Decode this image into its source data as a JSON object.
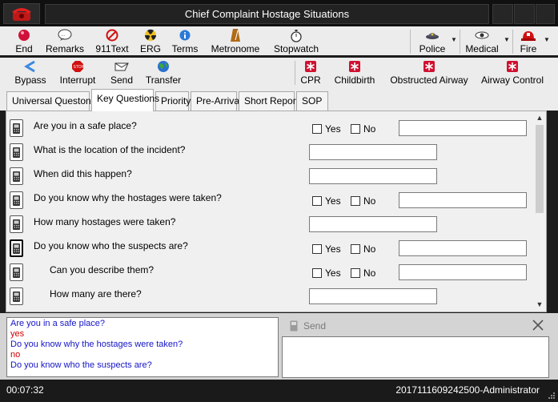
{
  "window": {
    "title": "Chief Complaint Hostage Situations"
  },
  "toolbar1": {
    "items": [
      {
        "label": "End",
        "icon": "red-ball-icon"
      },
      {
        "label": "Remarks",
        "icon": "speech-bubble-icon"
      },
      {
        "label": "911Text",
        "icon": "no-symbol-icon"
      },
      {
        "label": "ERG",
        "icon": "radiation-icon"
      },
      {
        "label": "Terms",
        "icon": "info-icon"
      },
      {
        "label": "Metronome",
        "icon": "metronome-icon"
      },
      {
        "label": "Stopwatch",
        "icon": "stopwatch-icon"
      },
      {
        "label": "Police",
        "icon": "police-hat-icon"
      },
      {
        "label": "Medical",
        "icon": "eye-icon"
      },
      {
        "label": "Fire",
        "icon": "fire-helmet-icon"
      }
    ]
  },
  "toolbar2": {
    "items": [
      {
        "label": "Bypass",
        "icon": "bypass-icon"
      },
      {
        "label": "Interrupt",
        "icon": "stop-sign-icon"
      },
      {
        "label": "Send",
        "icon": "send-icon"
      },
      {
        "label": "Transfer",
        "icon": "globe-icon"
      },
      {
        "label": "CPR",
        "icon": "medical-cross-icon"
      },
      {
        "label": "Childbirth",
        "icon": "medical-cross-icon"
      },
      {
        "label": "Obstructed Airway",
        "icon": "medical-cross-icon"
      },
      {
        "label": "Airway Control",
        "icon": "medical-cross-icon"
      }
    ]
  },
  "tabs": [
    {
      "label": "Universal Questons"
    },
    {
      "label": "Key Questions"
    },
    {
      "label": "Priority"
    },
    {
      "label": "Pre-Arrival"
    },
    {
      "label": "Short Report"
    },
    {
      "label": "SOP"
    }
  ],
  "questions": [
    {
      "text": "Are you in a safe place?",
      "type": "yes-no",
      "yes_label": "Yes",
      "no_label": "No"
    },
    {
      "text": "What is the location of the incident?",
      "type": "text"
    },
    {
      "text": "When did this happen?",
      "type": "text"
    },
    {
      "text": "Do you know why the hostages were taken?",
      "type": "yes-no",
      "yes_label": "Yes",
      "no_label": "No"
    },
    {
      "text": "How many hostages were taken?",
      "type": "text"
    },
    {
      "text": "Do you know who the suspects are?",
      "type": "yes-no",
      "yes_label": "Yes",
      "no_label": "No"
    },
    {
      "text": "Can you describe them?",
      "type": "yes-no",
      "yes_label": "Yes",
      "no_label": "No"
    },
    {
      "text": "How many are there?",
      "type": "text"
    }
  ],
  "transcript": [
    {
      "text": "Are you in a safe place?",
      "kind": "question"
    },
    {
      "text": "yes",
      "kind": "answer"
    },
    {
      "text": "Do you know why the hostages were taken?",
      "kind": "question"
    },
    {
      "text": "no",
      "kind": "answer"
    },
    {
      "text": "Do you know who the suspects are?",
      "kind": "question"
    }
  ],
  "send_panel": {
    "label": "Send"
  },
  "status": {
    "elapsed": "00:07:32",
    "session": "2017111609242500-Administrator"
  },
  "colors": {
    "question_text": "#1414c8",
    "answer_text": "#d00000",
    "title_bar": "#101010"
  }
}
